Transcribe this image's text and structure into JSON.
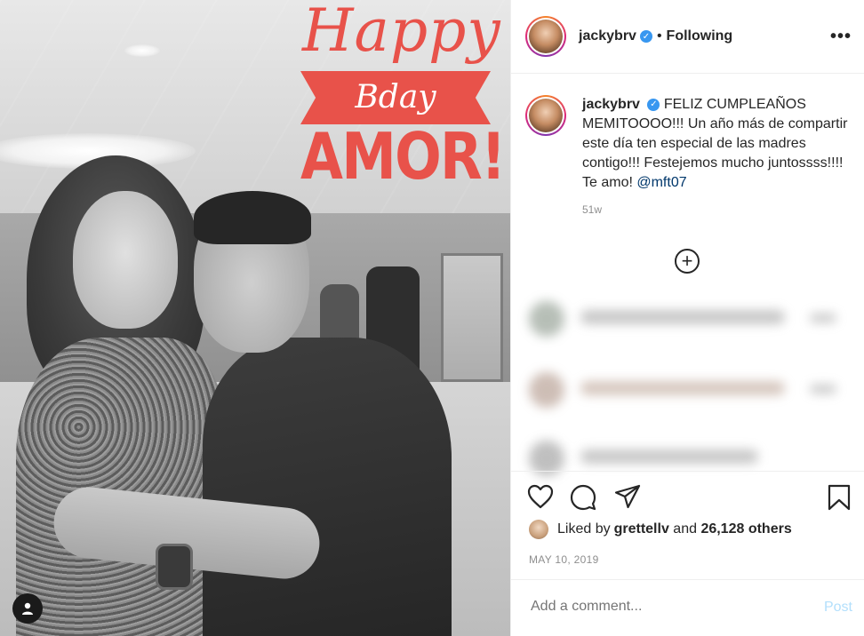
{
  "image_overlay": {
    "line1": "Happy",
    "line2": "Bday",
    "line3": "AMOR!"
  },
  "header": {
    "username": "jackybrv",
    "separator": "•",
    "follow_status": "Following",
    "more": "•••"
  },
  "caption": {
    "username": "jackybrv",
    "text": "FELIZ CUMPLEAÑOS MEMITOOOO!!! Un año más de compartir este día ten especial de las madres contigo!!! Festejemos mucho juntossss!!!! Te amo! ",
    "mention": "@mft07",
    "age": "51w"
  },
  "load_more": "+",
  "likes": {
    "prefix": "Liked by ",
    "user": "grettellv",
    "middle": " and ",
    "count": "26,128 others"
  },
  "date": "MAY 10, 2019",
  "comment": {
    "placeholder": "Add a comment...",
    "post_label": "Post"
  },
  "colors": {
    "overlay_accent": "#e8524a",
    "verified_blue": "#3897f0",
    "post_disabled": "#b2dffc",
    "mention": "#00376b"
  },
  "icons": [
    "user-tag-icon",
    "verified-icon",
    "more-icon",
    "plus-circle-icon",
    "heart-icon",
    "comment-icon",
    "share-icon",
    "bookmark-icon"
  ]
}
